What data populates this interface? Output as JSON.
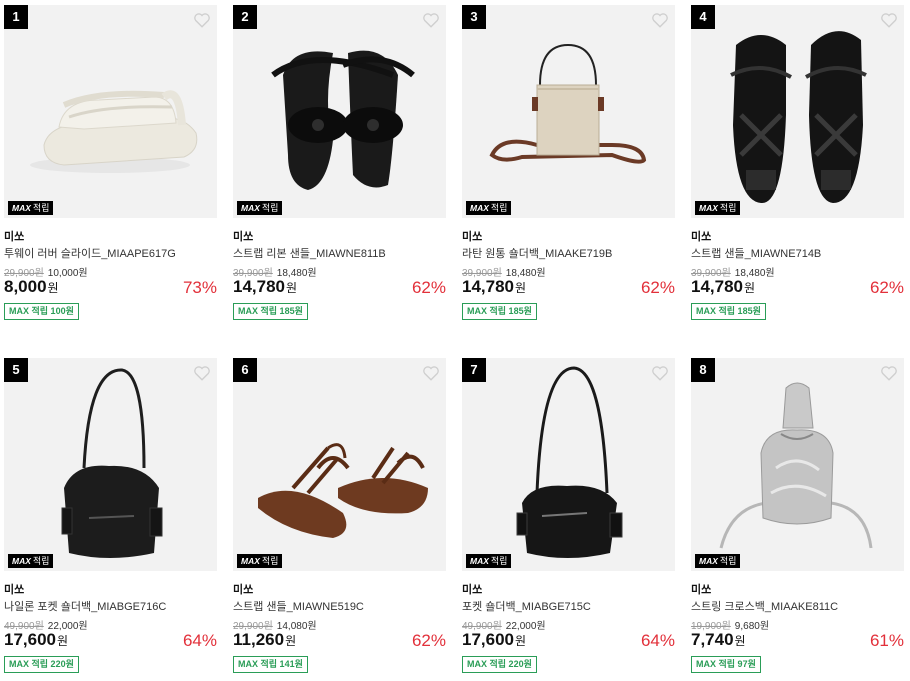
{
  "badge_label": {
    "max": "MAX",
    "text": "적립"
  },
  "colors": {
    "discount": "#e2303a",
    "points_border": "#2a9d57",
    "rank_bg": "#000000"
  },
  "products": [
    {
      "rank": "1",
      "brand": "미쏘",
      "name": "투웨이 러버 슬라이드_MIAAPE617G",
      "orig": "29,900원",
      "coupon": "10,000원",
      "price": "8,000",
      "won": "원",
      "discount": "73%",
      "points": "MAX 적립 100원",
      "image": "white-rubber-slide-sandal"
    },
    {
      "rank": "2",
      "brand": "미쏘",
      "name": "스트랩 리본 샌들_MIAWNE811B",
      "orig": "39,900원",
      "coupon": "18,480원",
      "price": "14,780",
      "won": "원",
      "discount": "62%",
      "points": "MAX 적립 185원",
      "image": "black-ribbon-sandal"
    },
    {
      "rank": "3",
      "brand": "미쏘",
      "name": "라탄 원통 숄더백_MIAAKE719B",
      "orig": "39,900원",
      "coupon": "18,480원",
      "price": "14,780",
      "won": "원",
      "discount": "62%",
      "points": "MAX 적립 185원",
      "image": "rattan-bucket-bag"
    },
    {
      "rank": "4",
      "brand": "미쏘",
      "name": "스트랩 샌들_MIAWNE714B",
      "orig": "39,900원",
      "coupon": "18,480원",
      "price": "14,780",
      "won": "원",
      "discount": "62%",
      "points": "MAX 적립 185원",
      "image": "black-patent-strap-sandal"
    },
    {
      "rank": "5",
      "brand": "미쏘",
      "name": "나일론 포켓 숄더백_MIABGE716C",
      "orig": "49,900원",
      "coupon": "22,000원",
      "price": "17,600",
      "won": "원",
      "discount": "64%",
      "points": "MAX 적립 220원",
      "image": "black-nylon-shoulder-bag"
    },
    {
      "rank": "6",
      "brand": "미쏘",
      "name": "스트랩 샌들_MIAWNE519C",
      "orig": "29,900원",
      "coupon": "14,080원",
      "price": "11,260",
      "won": "원",
      "discount": "62%",
      "points": "MAX 적립 141원",
      "image": "brown-strappy-sandal"
    },
    {
      "rank": "7",
      "brand": "미쏘",
      "name": "포켓 숄더백_MIABGE715C",
      "orig": "49,900원",
      "coupon": "22,000원",
      "price": "17,600",
      "won": "원",
      "discount": "64%",
      "points": "MAX 적립 220원",
      "image": "black-leather-pocket-bag"
    },
    {
      "rank": "8",
      "brand": "미쏘",
      "name": "스트링 크로스백_MIAAKE811C",
      "orig": "19,900원",
      "coupon": "9,680원",
      "price": "7,740",
      "won": "원",
      "discount": "61%",
      "points": "MAX 적립 97원",
      "image": "silver-string-cross-bag"
    }
  ]
}
